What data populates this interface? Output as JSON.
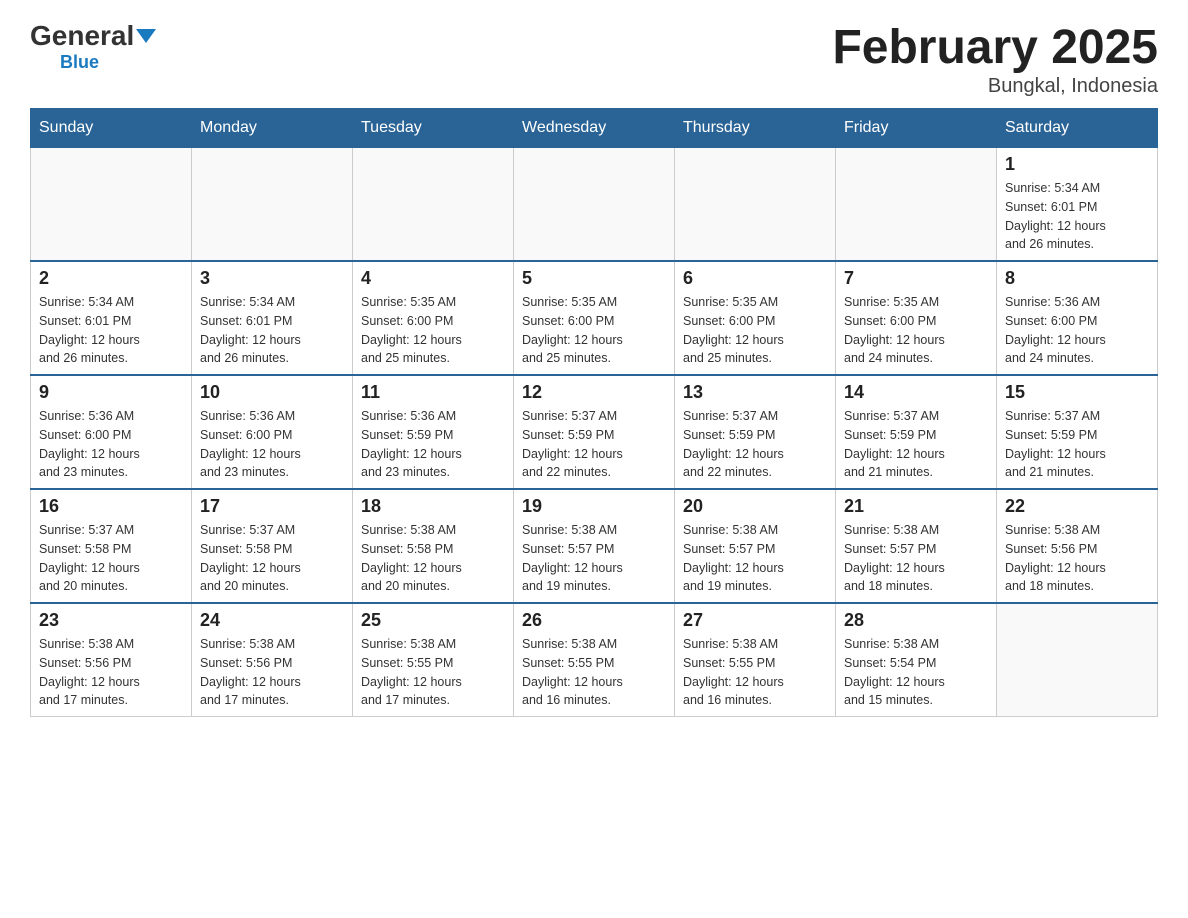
{
  "header": {
    "logo_general": "General",
    "logo_triangle": "",
    "logo_blue": "Blue",
    "month_title": "February 2025",
    "location": "Bungkal, Indonesia"
  },
  "calendar": {
    "days_of_week": [
      "Sunday",
      "Monday",
      "Tuesday",
      "Wednesday",
      "Thursday",
      "Friday",
      "Saturday"
    ],
    "weeks": [
      [
        {
          "day": "",
          "info": ""
        },
        {
          "day": "",
          "info": ""
        },
        {
          "day": "",
          "info": ""
        },
        {
          "day": "",
          "info": ""
        },
        {
          "day": "",
          "info": ""
        },
        {
          "day": "",
          "info": ""
        },
        {
          "day": "1",
          "info": "Sunrise: 5:34 AM\nSunset: 6:01 PM\nDaylight: 12 hours\nand 26 minutes."
        }
      ],
      [
        {
          "day": "2",
          "info": "Sunrise: 5:34 AM\nSunset: 6:01 PM\nDaylight: 12 hours\nand 26 minutes."
        },
        {
          "day": "3",
          "info": "Sunrise: 5:34 AM\nSunset: 6:01 PM\nDaylight: 12 hours\nand 26 minutes."
        },
        {
          "day": "4",
          "info": "Sunrise: 5:35 AM\nSunset: 6:00 PM\nDaylight: 12 hours\nand 25 minutes."
        },
        {
          "day": "5",
          "info": "Sunrise: 5:35 AM\nSunset: 6:00 PM\nDaylight: 12 hours\nand 25 minutes."
        },
        {
          "day": "6",
          "info": "Sunrise: 5:35 AM\nSunset: 6:00 PM\nDaylight: 12 hours\nand 25 minutes."
        },
        {
          "day": "7",
          "info": "Sunrise: 5:35 AM\nSunset: 6:00 PM\nDaylight: 12 hours\nand 24 minutes."
        },
        {
          "day": "8",
          "info": "Sunrise: 5:36 AM\nSunset: 6:00 PM\nDaylight: 12 hours\nand 24 minutes."
        }
      ],
      [
        {
          "day": "9",
          "info": "Sunrise: 5:36 AM\nSunset: 6:00 PM\nDaylight: 12 hours\nand 23 minutes."
        },
        {
          "day": "10",
          "info": "Sunrise: 5:36 AM\nSunset: 6:00 PM\nDaylight: 12 hours\nand 23 minutes."
        },
        {
          "day": "11",
          "info": "Sunrise: 5:36 AM\nSunset: 5:59 PM\nDaylight: 12 hours\nand 23 minutes."
        },
        {
          "day": "12",
          "info": "Sunrise: 5:37 AM\nSunset: 5:59 PM\nDaylight: 12 hours\nand 22 minutes."
        },
        {
          "day": "13",
          "info": "Sunrise: 5:37 AM\nSunset: 5:59 PM\nDaylight: 12 hours\nand 22 minutes."
        },
        {
          "day": "14",
          "info": "Sunrise: 5:37 AM\nSunset: 5:59 PM\nDaylight: 12 hours\nand 21 minutes."
        },
        {
          "day": "15",
          "info": "Sunrise: 5:37 AM\nSunset: 5:59 PM\nDaylight: 12 hours\nand 21 minutes."
        }
      ],
      [
        {
          "day": "16",
          "info": "Sunrise: 5:37 AM\nSunset: 5:58 PM\nDaylight: 12 hours\nand 20 minutes."
        },
        {
          "day": "17",
          "info": "Sunrise: 5:37 AM\nSunset: 5:58 PM\nDaylight: 12 hours\nand 20 minutes."
        },
        {
          "day": "18",
          "info": "Sunrise: 5:38 AM\nSunset: 5:58 PM\nDaylight: 12 hours\nand 20 minutes."
        },
        {
          "day": "19",
          "info": "Sunrise: 5:38 AM\nSunset: 5:57 PM\nDaylight: 12 hours\nand 19 minutes."
        },
        {
          "day": "20",
          "info": "Sunrise: 5:38 AM\nSunset: 5:57 PM\nDaylight: 12 hours\nand 19 minutes."
        },
        {
          "day": "21",
          "info": "Sunrise: 5:38 AM\nSunset: 5:57 PM\nDaylight: 12 hours\nand 18 minutes."
        },
        {
          "day": "22",
          "info": "Sunrise: 5:38 AM\nSunset: 5:56 PM\nDaylight: 12 hours\nand 18 minutes."
        }
      ],
      [
        {
          "day": "23",
          "info": "Sunrise: 5:38 AM\nSunset: 5:56 PM\nDaylight: 12 hours\nand 17 minutes."
        },
        {
          "day": "24",
          "info": "Sunrise: 5:38 AM\nSunset: 5:56 PM\nDaylight: 12 hours\nand 17 minutes."
        },
        {
          "day": "25",
          "info": "Sunrise: 5:38 AM\nSunset: 5:55 PM\nDaylight: 12 hours\nand 17 minutes."
        },
        {
          "day": "26",
          "info": "Sunrise: 5:38 AM\nSunset: 5:55 PM\nDaylight: 12 hours\nand 16 minutes."
        },
        {
          "day": "27",
          "info": "Sunrise: 5:38 AM\nSunset: 5:55 PM\nDaylight: 12 hours\nand 16 minutes."
        },
        {
          "day": "28",
          "info": "Sunrise: 5:38 AM\nSunset: 5:54 PM\nDaylight: 12 hours\nand 15 minutes."
        },
        {
          "day": "",
          "info": ""
        }
      ]
    ]
  }
}
